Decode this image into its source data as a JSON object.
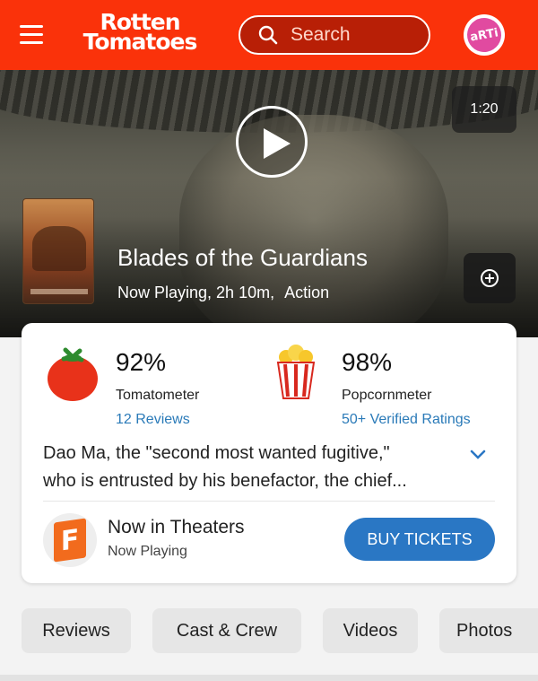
{
  "header": {
    "logo_line1": "Rotten",
    "logo_line2": "Tomatoes",
    "search_placeholder": "Search",
    "avatar_text": "aRTi",
    "brand_color": "#fa320a"
  },
  "hero": {
    "duration": "1:20",
    "title": "Blades of the Guardians",
    "status": "Now Playing, 2h 10m,",
    "genre": "Action"
  },
  "scores": {
    "tomatometer": {
      "value": "92%",
      "label": "Tomatometer",
      "link": "12 Reviews"
    },
    "popcornmeter": {
      "value": "98%",
      "label": "Popcornmeter",
      "link": "50+ Verified Ratings"
    },
    "synopsis_line1": "Dao Ma, the \"second most wanted fugitive,\"",
    "synopsis_line2": "who is entrusted by his benefactor, the chief..."
  },
  "theaters": {
    "title": "Now in Theaters",
    "subtitle": "Now Playing",
    "buy_label": "BUY TICKETS",
    "button_color": "#2a77c4"
  },
  "tabs": [
    "Reviews",
    "Cast & Crew",
    "Videos",
    "Photos"
  ]
}
